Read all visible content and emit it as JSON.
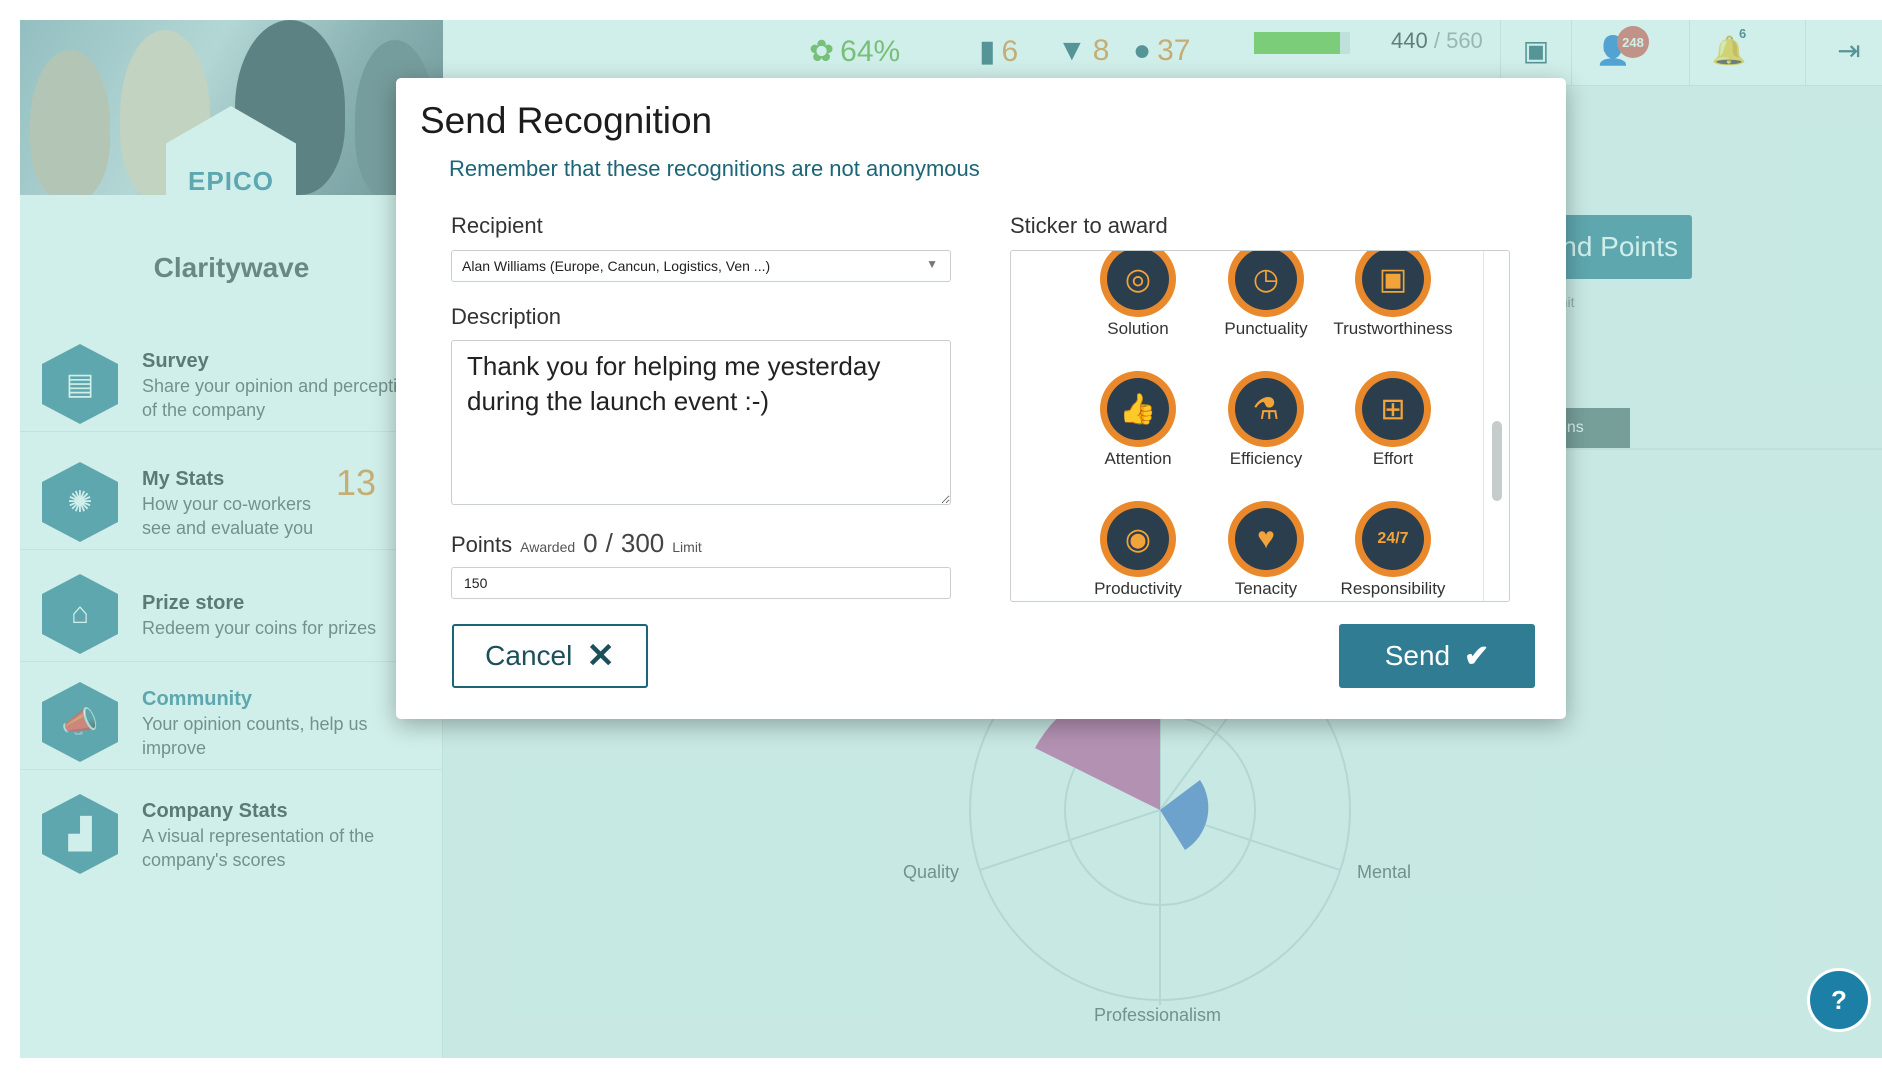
{
  "topbar": {
    "percent": "64%",
    "trophies": "6",
    "awards": "8",
    "coins": "37",
    "progress_fraction": 0.9,
    "score": "440",
    "score_max": "560",
    "user_badge": "248",
    "notification_badge": "6"
  },
  "sidebar": {
    "logo": "EPICO",
    "company": "Claritywave",
    "items": [
      {
        "title": "Survey",
        "desc": "Share your opinion and perceptions of the company"
      },
      {
        "title": "My Stats",
        "desc": "How your co-workers see and evaluate you",
        "num": "13"
      },
      {
        "title": "Prize store",
        "desc": "Redeem your coins for prizes"
      },
      {
        "title": "Community",
        "desc": "Your opinion counts, help us improve"
      },
      {
        "title": "Company Stats",
        "desc": "A visual representation of the company's scores"
      }
    ]
  },
  "main": {
    "send_points_partial": "nd Points",
    "limit_label": "Limit",
    "tab_partial": "ons",
    "radar": {
      "labels": [
        "Quality",
        "Mental",
        "Professionalism"
      ]
    }
  },
  "modal": {
    "title": "Send Recognition",
    "subtitle": "Remember that these recognitions are not anonymous",
    "recipient_label": "Recipient",
    "recipient_value": "Alan Williams (Europe, Cancun, Logistics, Ven ...)",
    "description_label": "Description",
    "description_value": "Thank you for helping me yesterday during the launch event :-)",
    "points_label": "Points",
    "points_awarded_label": "Awarded",
    "points_awarded": "0",
    "points_separator": "/",
    "points_limit": "300",
    "points_limit_label": "Limit",
    "points_value": "150",
    "sticker_label": "Sticker to award",
    "stickers": [
      {
        "name": "Solution",
        "icon": "target-icon"
      },
      {
        "name": "Punctuality",
        "icon": "clock-icon"
      },
      {
        "name": "Trustworthiness",
        "icon": "safe-icon"
      },
      {
        "name": "Attention",
        "icon": "thumbs-up-icon"
      },
      {
        "name": "Efficiency",
        "icon": "flask-icon"
      },
      {
        "name": "Effort",
        "icon": "barbell-icon"
      },
      {
        "name": "Productivity",
        "icon": "coins-icon"
      },
      {
        "name": "Tenacity",
        "icon": "cards-icon"
      },
      {
        "name": "Responsibility",
        "icon": "24-7-sign-icon"
      }
    ],
    "cancel_label": "Cancel",
    "send_label": "Send"
  },
  "colors": {
    "primary": "#2f7c93",
    "accent_orange": "#e9892b",
    "overlay": "#98dcd0"
  }
}
